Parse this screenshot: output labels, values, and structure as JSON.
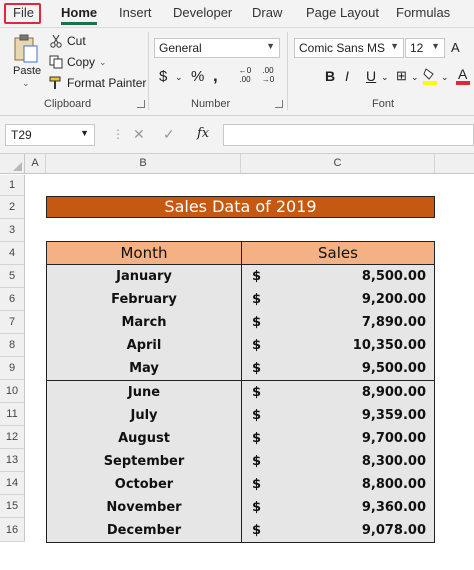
{
  "ribbon_tabs": [
    "File",
    "Home",
    "Insert",
    "Developer",
    "Draw",
    "Page Layout",
    "Formulas"
  ],
  "clipboard": {
    "paste": "Paste",
    "cut": "Cut",
    "copy": "Copy",
    "format_painter": "Format Painter",
    "group_label": "Clipboard"
  },
  "number": {
    "format": "General",
    "group_label": "Number"
  },
  "font": {
    "name": "Comic Sans MS",
    "size": "12",
    "group_label": "Font",
    "bold": "B",
    "italic": "I",
    "underline": "U"
  },
  "formula_bar": {
    "name_box": "T29",
    "fx": "fx",
    "value": ""
  },
  "columns": [
    "A",
    "B",
    "C"
  ],
  "rows": [
    "1",
    "2",
    "3",
    "4",
    "5",
    "6",
    "7",
    "8",
    "9",
    "10",
    "11",
    "12",
    "13",
    "14",
    "15",
    "16"
  ],
  "sheet": {
    "title": "Sales Data of 2019",
    "headers": {
      "month": "Month",
      "sales": "Sales"
    },
    "currency": "$",
    "data": [
      {
        "month": "January",
        "sales": "8,500.00"
      },
      {
        "month": "February",
        "sales": "9,200.00"
      },
      {
        "month": "March",
        "sales": "7,890.00"
      },
      {
        "month": "April",
        "sales": "10,350.00"
      },
      {
        "month": "May",
        "sales": "9,500.00"
      },
      {
        "month": "June",
        "sales": "8,900.00"
      },
      {
        "month": "July",
        "sales": "9,359.00"
      },
      {
        "month": "August",
        "sales": "9,700.00"
      },
      {
        "month": "September",
        "sales": "8,300.00"
      },
      {
        "month": "October",
        "sales": "8,800.00"
      },
      {
        "month": "November",
        "sales": "9,360.00"
      },
      {
        "month": "December",
        "sales": "9,078.00"
      }
    ]
  },
  "colors": {
    "title_fill": "#c65911",
    "header_fill": "#f4b183",
    "row_fill": "#e7e6e6",
    "accent": "#1e7145",
    "file_highlight": "#e0283a"
  }
}
